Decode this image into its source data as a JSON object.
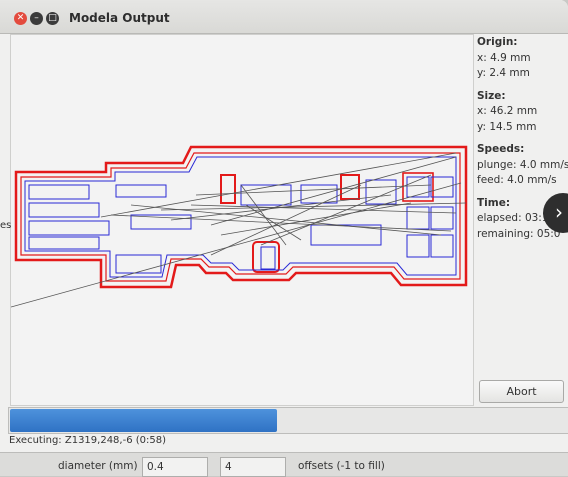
{
  "window": {
    "title": "Modela Output"
  },
  "info": {
    "origin": {
      "heading": "Origin:",
      "x": "x: 4.9 mm",
      "y": "y: 2.4 mm"
    },
    "size": {
      "heading": "Size:",
      "x": "x: 46.2 mm",
      "y": "y: 14.5 mm"
    },
    "speeds": {
      "heading": "Speeds:",
      "plunge": "plunge: 4.0 mm/s",
      "feed": "feed: 4.0 mm/s"
    },
    "time": {
      "heading": "Time:",
      "elapsed": "elapsed: 03:1",
      "remaining": "remaining: 05:0"
    }
  },
  "buttons": {
    "abort": "Abort"
  },
  "progress": {
    "fraction": 0.48
  },
  "status": {
    "executing": "Executing: Z1319,248,-6 (0:58)"
  },
  "bottom_panel": {
    "diameter_label": "diameter (mm)",
    "diameter_value": "0.4",
    "offsets_value": "4",
    "offsets_label": "offsets (-1 to fill)"
  },
  "left_fragment": "es",
  "colors": {
    "outline": "#e31a1a",
    "offset": "#2a2ad6",
    "travel": "#555555",
    "progress": "#3a7fd5"
  },
  "icons": [
    "close-icon",
    "minimize-icon",
    "maximize-icon",
    "chevron-right-icon"
  ]
}
